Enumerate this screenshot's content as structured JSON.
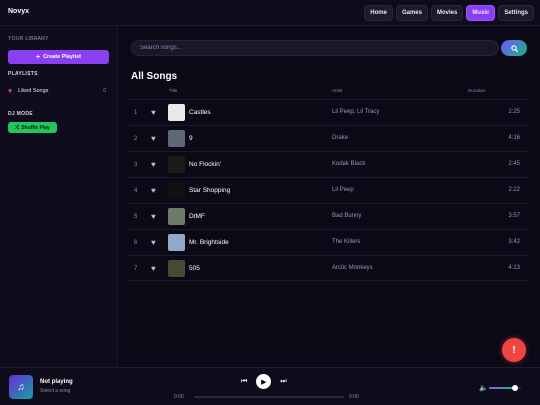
{
  "header": {
    "brand": "Novyx",
    "nav": [
      {
        "label": "Home",
        "active": false
      },
      {
        "label": "Games",
        "active": false
      },
      {
        "label": "Movies",
        "active": false
      },
      {
        "label": "Music",
        "active": true
      },
      {
        "label": "Settings",
        "active": false
      }
    ]
  },
  "sidebar": {
    "library_label": "YOUR LIBRARY",
    "create_playlist_label": "Create Playlist",
    "playlists_label": "PLAYLISTS",
    "liked_songs": {
      "label": "Liked Songs",
      "count": "0"
    },
    "dj_mode_label": "DJ MODE",
    "shuffle_label": "Shuffle Play"
  },
  "main": {
    "search_placeholder": "Search songs...",
    "section_title": "All Songs",
    "columns": {
      "title": "Title",
      "artist": "Artist",
      "duration": "Duration"
    },
    "tracks": [
      {
        "num": "1",
        "title": "Castles",
        "artist": "Lil Peep, Lil Tracy",
        "duration": "2:25",
        "art": "#e9e9e9"
      },
      {
        "num": "2",
        "title": "9",
        "artist": "Drake",
        "duration": "4:16",
        "art": "#5d6a73"
      },
      {
        "num": "3",
        "title": "No Flockin'",
        "artist": "Kodak Black",
        "duration": "2:45",
        "art": "#1b1a13"
      },
      {
        "num": "4",
        "title": "Star Shopping",
        "artist": "Lil Peep",
        "duration": "2:22",
        "art": "#111111"
      },
      {
        "num": "5",
        "title": "DtMF",
        "artist": "Bad Bunny",
        "duration": "3:57",
        "art": "#6e7b68"
      },
      {
        "num": "6",
        "title": "Mr. Brightside",
        "artist": "The Killers",
        "duration": "3:42",
        "art": "#8fa9c9"
      },
      {
        "num": "7",
        "title": "505",
        "artist": "Arctic Monkeys",
        "duration": "4:13",
        "art": "#4b4836"
      }
    ]
  },
  "player": {
    "now_playing": "Not playing",
    "subtitle": "Select a song",
    "time_current": "0:00",
    "time_total": "0:00",
    "progress": 0,
    "volume": 0.8
  },
  "colors": {
    "accent": "#8b3ff5",
    "green": "#22c55e",
    "red": "#ef4444"
  }
}
